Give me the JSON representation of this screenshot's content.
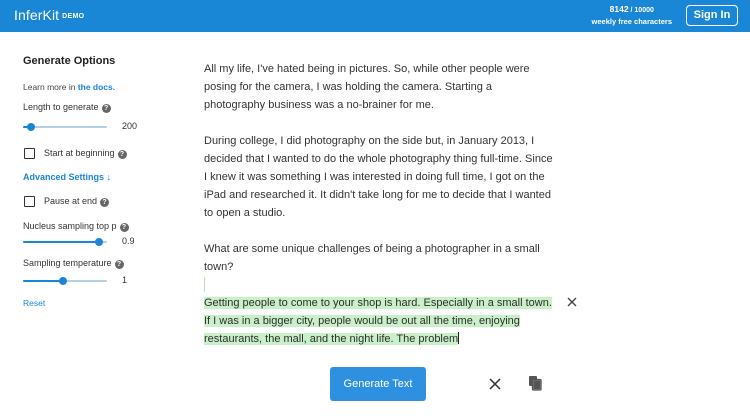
{
  "header": {
    "logo_name": "InferKit",
    "logo_badge": "DEMO",
    "usage_used": "8142",
    "usage_sep": " / ",
    "usage_total": "10000",
    "usage_label": "weekly free characters",
    "signin_label": "Sign In",
    "color": "#1a86d6"
  },
  "sidebar": {
    "title": "Generate Options",
    "learn_prefix": "Learn more in ",
    "learn_link": "the docs.",
    "length": {
      "label": "Length to generate",
      "help": "?",
      "value": "200",
      "fraction": 0.1
    },
    "start_at_beginning": {
      "label": "Start at beginning",
      "help": "?",
      "checked": false
    },
    "advanced_label": "Advanced Settings ↓",
    "pause_at_end": {
      "label": "Pause at end",
      "help": "?",
      "checked": false
    },
    "nucleus": {
      "label": "Nucleus sampling top p",
      "help": "?",
      "value": "0.9",
      "fraction": 0.9
    },
    "temperature": {
      "label": "Sampling temperature",
      "help": "?",
      "value": "1",
      "fraction": 0.48
    },
    "reset_label": "Reset"
  },
  "prompt": {
    "paragraphs": [
      "All my life, I've hated being in pictures. So, while other people were posing for the camera, I was holding the camera. Starting a photography business was a no-brainer for me.",
      "During college, I did photography on the side but, in January 2013, I decided that I wanted to do the whole photography thing full-time. Since I knew it was something I was interested in doing full time, I got on the iPad and researched it. It didn't take long for me to decide that I wanted to open a studio.",
      "What are some unique challenges of being a photographer in a small town?"
    ]
  },
  "generated": {
    "text": "Getting people to come to your shop is hard. Especially in a small town. If I was in a bigger city, people would be out all the time, enjoying restaurants, the mall, and the night life. The problem",
    "highlight_color": "#c9f0c9"
  },
  "actions": {
    "generate_label": "Generate Text",
    "clear_icon": "close-icon",
    "copy_icon": "copy-icon"
  }
}
